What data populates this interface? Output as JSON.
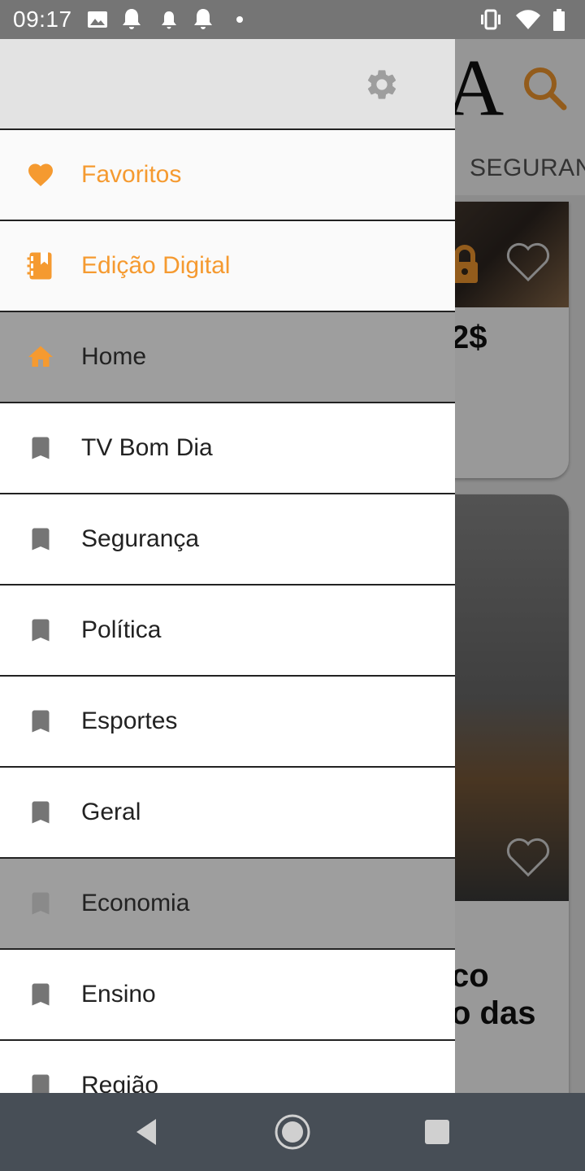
{
  "status_bar": {
    "time": "09:17",
    "left_icons": [
      "image-icon",
      "bell-icon",
      "bell-icon",
      "bell-icon",
      "dot-icon"
    ],
    "right_icons": [
      "vibrate-icon",
      "wifi-icon",
      "battery-icon"
    ]
  },
  "background": {
    "logo_letter": "A",
    "tab_label": "SEGURAN",
    "card1_text": "2$",
    "card2_line1": "co",
    "card2_line2": "o das"
  },
  "drawer": {
    "settings_icon": "gear-icon",
    "items": [
      {
        "label": "Favoritos",
        "icon": "heart-icon",
        "style": "accent"
      },
      {
        "label": "Edição Digital",
        "icon": "book-icon",
        "style": "accent"
      },
      {
        "label": "Home",
        "icon": "home-icon",
        "style": "selected"
      },
      {
        "label": "TV Bom Dia",
        "icon": "bookmark-icon",
        "style": "plain"
      },
      {
        "label": "Segurança",
        "icon": "bookmark-icon",
        "style": "plain"
      },
      {
        "label": "Política",
        "icon": "bookmark-icon",
        "style": "plain"
      },
      {
        "label": "Esportes",
        "icon": "bookmark-icon",
        "style": "plain"
      },
      {
        "label": "Geral",
        "icon": "bookmark-icon",
        "style": "plain"
      },
      {
        "label": "Economia",
        "icon": "bookmark-icon",
        "style": "selected"
      },
      {
        "label": "Ensino",
        "icon": "bookmark-icon",
        "style": "plain"
      },
      {
        "label": "Região",
        "icon": "bookmark-icon",
        "style": "plain"
      }
    ]
  },
  "colors": {
    "accent": "#F59A30",
    "status_bar": "#757575",
    "nav_bar": "#474e56",
    "selected_row": "#9e9e9e",
    "icon_gray": "#757575"
  },
  "nav_bar": {
    "buttons": [
      "back-icon",
      "home-circle-icon",
      "recents-icon"
    ]
  }
}
